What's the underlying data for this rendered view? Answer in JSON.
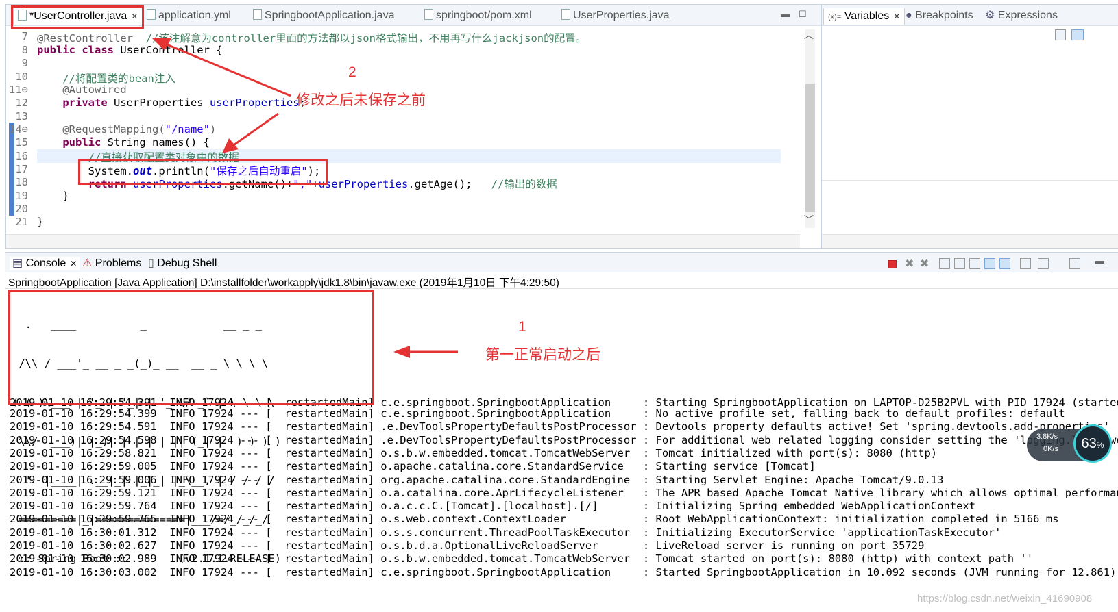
{
  "editor": {
    "tabs": [
      {
        "label": "*UserController.java",
        "active": true
      },
      {
        "label": "application.yml"
      },
      {
        "label": "SpringbootApplication.java"
      },
      {
        "label": "springboot/pom.xml"
      },
      {
        "label": "UserProperties.java"
      }
    ],
    "lines": [
      {
        "num": "7",
        "code": "@RestController  //该注解意为controller里面的方法都以json格式输出，不用再写什么jackjson的配置。"
      },
      {
        "num": "8",
        "code": "public class UserController {"
      },
      {
        "num": "9",
        "code": ""
      },
      {
        "num": "10",
        "code": "    //将配置类的bean注入"
      },
      {
        "num": "11⊖",
        "code": "    @Autowired"
      },
      {
        "num": "12",
        "code": "    private UserProperties userProperties;"
      },
      {
        "num": "13",
        "code": ""
      },
      {
        "num": "14⊖",
        "code": "    @RequestMapping(\"/name\")"
      },
      {
        "num": "15",
        "code": "    public String names() {"
      },
      {
        "num": "16",
        "code": "        //直接获取配置类对象中的数据"
      },
      {
        "num": "17",
        "code": "        System.out.println(\"保存之后自动重启\");"
      },
      {
        "num": "18",
        "code": "        return userProperties.getName()+\",\"+userProperties.getAge();   //输出的数据"
      },
      {
        "num": "19",
        "code": "    }"
      },
      {
        "num": "20",
        "code": ""
      },
      {
        "num": "21",
        "code": "}"
      }
    ],
    "code_tokens": {
      "l7_anno": "@RestController",
      "l7_comment": "//该注解意为controller里面的方法都以json格式输出，不用再写什么jackjson的配置。",
      "l8_kw": "public class",
      "l8_rest": " UserController {",
      "l10_comment": "//将配置类的bean注入",
      "l11_anno": "@Autowired",
      "l12_kw": "private",
      "l12_type": " UserProperties ",
      "l12_field": "userProperties",
      "l12_end": ";",
      "l14_anno": "@RequestMapping(",
      "l14_str": "\"/name\"",
      "l14_end": ")",
      "l15_kw": "public",
      "l15_rest": " String names() {",
      "l16_comment": "//直接获取配置类对象中的数据",
      "l17_pre": "System.",
      "l17_out": "out",
      "l17_mid": ".println(",
      "l17_str": "\"保存之后自动重启\"",
      "l17_end": ");",
      "l18_kw": "return",
      "l18_f1": " userProperties",
      "l18_m1": ".getName()+",
      "l18_str": "\",\"",
      "l18_plus": "+",
      "l18_f2": "userProperties",
      "l18_m2": ".getAge();",
      "l18_comment": "   //输出的数据",
      "l19": "}",
      "l21": "}"
    }
  },
  "variables": {
    "tabs": [
      {
        "label": "Variables",
        "active": true
      },
      {
        "label": "Breakpoints"
      },
      {
        "label": "Expressions"
      }
    ]
  },
  "console": {
    "tabs": [
      {
        "label": "Console",
        "active": true
      },
      {
        "label": "Problems"
      },
      {
        "label": "Debug Shell"
      }
    ],
    "launch_line": "SpringbootApplication [Java Application] D:\\installfolder\\workapply\\jdk1.8\\bin\\javaw.exe (2019年1月10日 下午4:29:50)",
    "banner": [
      "  .   ____          _            __ _ _",
      " /\\\\ / ___'_ __ _ _(_)_ __  __ _ \\ \\ \\ \\",
      "( ( )\\___ | '_ | '_| | '_ \\/ _` | \\ \\ \\ \\",
      " \\\\/  ___)| |_)| | | | | || (_| |  ) ) ) )",
      "  '  |____| .__|_| |_|_| |_\\__, | / / / /",
      " =========|_|==============|___/=/_/_/_/",
      " :: Spring Boot ::        (v2.1.1.RELEASE)"
    ],
    "logs": [
      "2019-01-10 16:29:54.391  INFO 17924 --- [  restartedMain] c.e.springboot.SpringbootApplication     : Starting SpringbootApplication on LAPTOP-D25B2PVL with PID 17924 (started by 石",
      "2019-01-10 16:29:54.399  INFO 17924 --- [  restartedMain] c.e.springboot.SpringbootApplication     : No active profile set, falling back to default profiles: default",
      "2019-01-10 16:29:54.591  INFO 17924 --- [  restartedMain] .e.DevToolsPropertyDefaultsPostProcessor : Devtools property defaults active! Set 'spring.devtools.add-properties'",
      "2019-01-10 16:29:54.598  INFO 17924 --- [  restartedMain] .e.DevToolsPropertyDefaultsPostProcessor : For additional web related logging consider setting the 'logging.level.web' pro",
      "2019-01-10 16:29:58.821  INFO 17924 --- [  restartedMain] o.s.b.w.embedded.tomcat.TomcatWebServer  : Tomcat initialized with port(s): 8080 (http)",
      "2019-01-10 16:29:59.005  INFO 17924 --- [  restartedMain] o.apache.catalina.core.StandardService   : Starting service [Tomcat]",
      "2019-01-10 16:29:59.006  INFO 17924 --- [  restartedMain] org.apache.catalina.core.StandardEngine  : Starting Servlet Engine: Apache Tomcat/9.0.13",
      "2019-01-10 16:29:59.121  INFO 17924 --- [  restartedMain] o.a.catalina.core.AprLifecycleListener   : The APR based Apache Tomcat Native library which allows optimal performance in",
      "2019-01-10 16:29:59.764  INFO 17924 --- [  restartedMain] o.a.c.c.C.[Tomcat].[localhost].[/]       : Initializing Spring embedded WebApplicationContext",
      "2019-01-10 16:29:59.765  INFO 17924 --- [  restartedMain] o.s.web.context.ContextLoader            : Root WebApplicationContext: initialization completed in 5166 ms",
      "2019-01-10 16:30:01.312  INFO 17924 --- [  restartedMain] o.s.s.concurrent.ThreadPoolTaskExecutor  : Initializing ExecutorService 'applicationTaskExecutor'",
      "2019-01-10 16:30:02.627  INFO 17924 --- [  restartedMain] o.s.b.d.a.OptionalLiveReloadServer       : LiveReload server is running on port 35729",
      "2019-01-10 16:30:02.989  INFO 17924 --- [  restartedMain] o.s.b.w.embedded.tomcat.TomcatWebServer  : Tomcat started on port(s): 8080 (http) with context path ''",
      "2019-01-10 16:30:03.002  INFO 17924 --- [  restartedMain] c.e.springboot.SpringbootApplication     : Started SpringbootApplication in 10.092 seconds (JVM running for 12.861)"
    ]
  },
  "annotations": {
    "label_1_num": "1",
    "label_1_text": "第一正常启动之后",
    "label_2_num": "2",
    "label_2_text": "修改之后未保存之前",
    "color": "#e53333"
  },
  "net_widget": {
    "up": "3.8K/s",
    "down": "0K/s",
    "percent": "63",
    "percent_sign": "%"
  },
  "watermark": "https://blog.csdn.net/weixin_41690908"
}
